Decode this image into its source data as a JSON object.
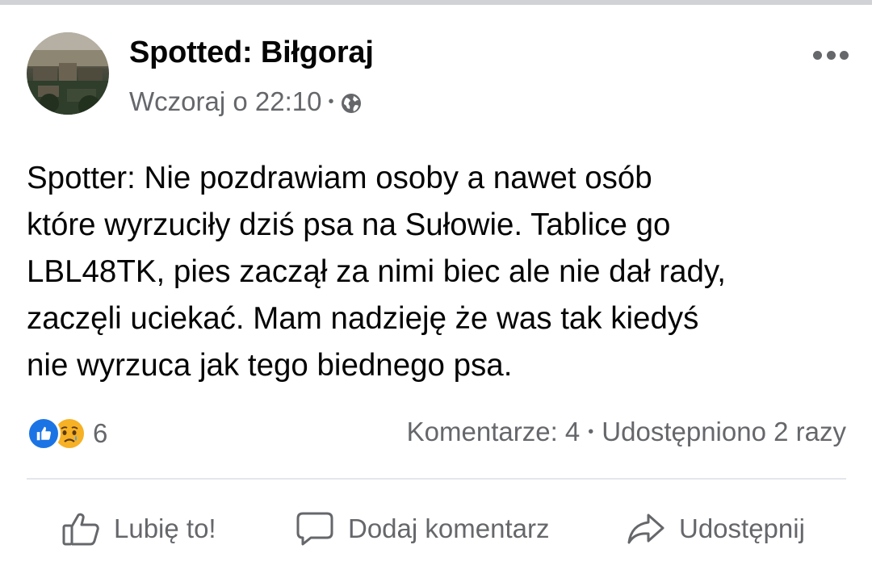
{
  "post": {
    "page_name": "Spotted: Biłgoraj",
    "timestamp": "Wczoraj o 22:10",
    "meta_separator": "•",
    "privacy_icon": "globe-icon",
    "more_icon": "more-options-icon",
    "text": "Spotter: Nie pozdrawiam osoby a nawet osób\nktóre wyrzuciły dziś psa na Sułowie. Tablice go\nLBL48TK, pies zaczął za nimi biec ale nie dał rady,\nzaczęli uciekać. Mam nadzieję że was tak kiedyś\nnie wyrzuca jak tego biednego psa."
  },
  "stats": {
    "reactions": [
      "like",
      "sad"
    ],
    "reaction_count": "6",
    "comments": "Komentarze: 4",
    "separator": "•",
    "shares": "Udostępniono 2 razy"
  },
  "actions": {
    "like_label": "Lubię to!",
    "comment_label": "Dodaj komentarz",
    "share_label": "Udostępnij"
  },
  "colors": {
    "text": "#050505",
    "secondary": "#65676b",
    "like_blue": "#1b74e4",
    "sad_yellow": "#f7b125",
    "divider": "#e4e6eb"
  }
}
